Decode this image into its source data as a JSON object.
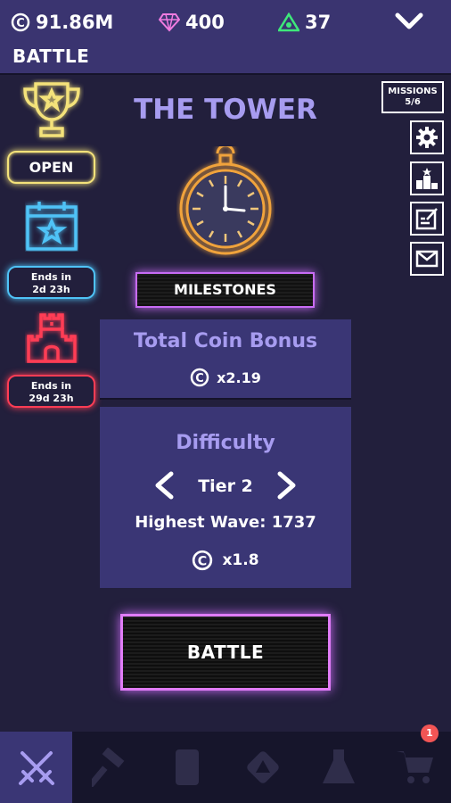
{
  "header": {
    "coins": "91.86M",
    "gems": "400",
    "medals": "37",
    "screen_title": "BATTLE",
    "icons": {
      "coin": "coin-icon",
      "gem": "gem-icon",
      "medal": "triangle-medal-icon",
      "collapse": "chevron-down-icon"
    }
  },
  "left_column": {
    "trophy_label": "OPEN",
    "event_timer_line1": "Ends in",
    "event_timer_line2": "2d 23h",
    "castle_timer_line1": "Ends in",
    "castle_timer_line2": "29d 23h"
  },
  "right_column": {
    "missions_label": "MISSIONS",
    "missions_progress": "5/6",
    "buttons": [
      "gear-icon",
      "leaderboard-icon",
      "notepad-icon",
      "mail-icon"
    ]
  },
  "main": {
    "title": "THE TOWER",
    "milestones_label": "MILESTONES",
    "coin_bonus_title": "Total Coin Bonus",
    "coin_bonus_value": "x2.19",
    "difficulty_title": "Difficulty",
    "tier_label": "Tier 2",
    "highest_wave": "Highest Wave: 1737",
    "difficulty_multiplier": "x1.8",
    "battle_label": "BATTLE"
  },
  "bottom_nav": {
    "items": [
      "crossed-swords-icon",
      "hammer-icon",
      "card-icon",
      "triangle-icon",
      "flask-icon",
      "cart-icon"
    ],
    "selected_index": 0,
    "cart_badge": "1"
  },
  "colors": {
    "topbar": "#3a3470",
    "background": "#221f3c",
    "panel": "#3a3675",
    "accent_text": "#a79cf0",
    "neon_gold": "#f4e27a",
    "neon_blue": "#4fc3f7",
    "neon_red": "#ff3d55",
    "neon_purple": "#c86cf5"
  }
}
